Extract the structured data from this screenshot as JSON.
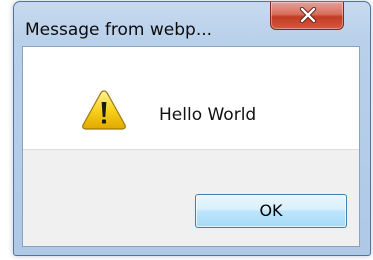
{
  "dialog": {
    "title": "Message from webp...",
    "message": "Hello World",
    "ok_label": "OK",
    "close_icon": "close-x-icon",
    "message_icon": "warning-triangle-icon"
  },
  "colors": {
    "close_button": "#c8442d",
    "ok_button_border": "#3c7fb1",
    "titlebar": "#b9d0ea",
    "warning_yellow": "#f5c400"
  }
}
